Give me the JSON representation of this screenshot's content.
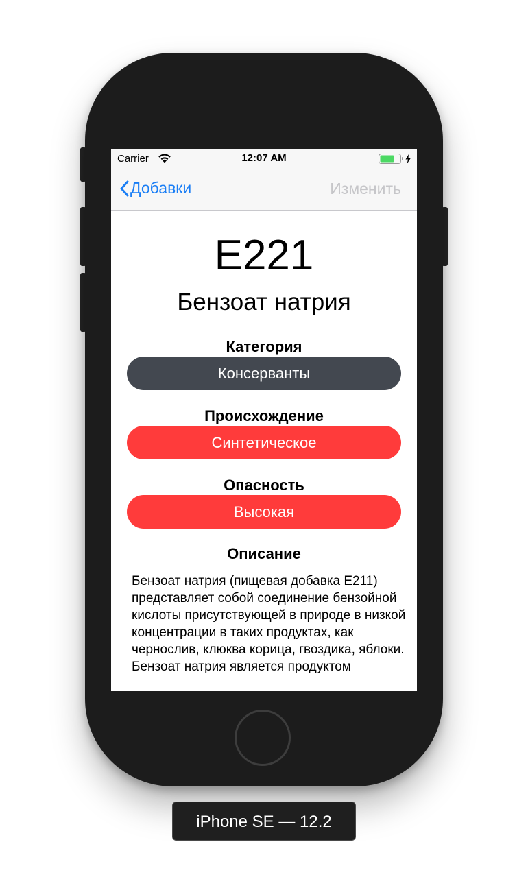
{
  "status_bar": {
    "carrier": "Carrier",
    "time": "12:07 AM",
    "battery_color": "#4cd964"
  },
  "nav": {
    "back_label": "Добавки",
    "edit_label": "Изменить",
    "back_icon": "chevron-left-icon",
    "accent_color": "#1a7ef5"
  },
  "additive": {
    "code": "E221",
    "name": "Бензоат натрия"
  },
  "sections": {
    "category": {
      "title": "Категория",
      "value": "Консерванты",
      "color": "#434850"
    },
    "origin": {
      "title": "Происхождение",
      "value": "Синтетическое",
      "color": "#ff3b3b"
    },
    "danger": {
      "title": "Опасность",
      "value": "Высокая",
      "color": "#ff3b3b"
    },
    "description": {
      "title": "Описание",
      "text": "Бензоат натрия (пищевая добавка E211) представляет собой соединение бензойной кислоты присутствующей в природе в низкой концентрации в таких продуктах, как чернослив, клюква корица, гвоздика, яблоки. Бензоат натрия является продуктом"
    }
  },
  "device": {
    "label": "iPhone SE — 12.2"
  }
}
